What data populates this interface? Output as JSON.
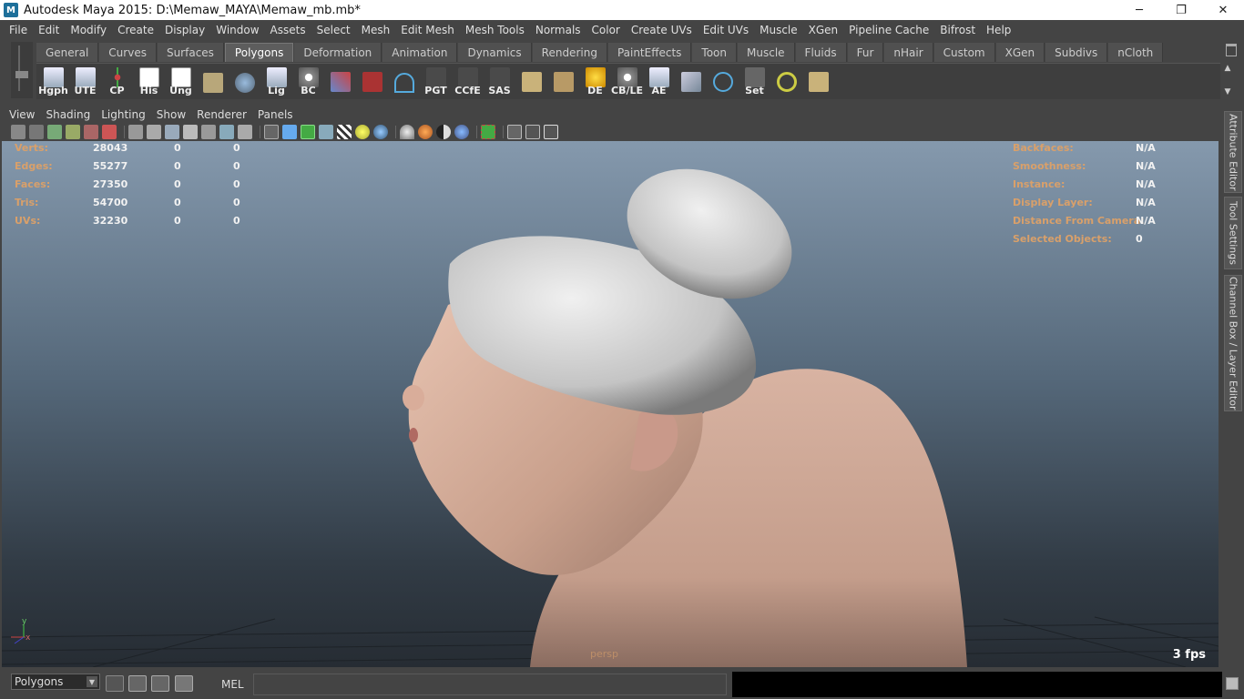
{
  "titlebar": {
    "title": "Autodesk Maya 2015: D:\\Memaw_MAYA\\Memaw_mb.mb*",
    "app_icon": "M",
    "minimize": "─",
    "restore": "❐",
    "close": "✕"
  },
  "menubar": [
    "File",
    "Edit",
    "Modify",
    "Create",
    "Display",
    "Window",
    "Assets",
    "Select",
    "Mesh",
    "Edit Mesh",
    "Mesh Tools",
    "Normals",
    "Color",
    "Create UVs",
    "Edit UVs",
    "Muscle",
    "XGen",
    "Pipeline Cache",
    "Bifrost",
    "Help"
  ],
  "shelf_tabs": [
    "General",
    "Curves",
    "Surfaces",
    "Polygons",
    "Deformation",
    "Animation",
    "Dynamics",
    "Rendering",
    "PaintEffects",
    "Toon",
    "Muscle",
    "Fluids",
    "Fur",
    "nHair",
    "Custom",
    "XGen",
    "Subdivs",
    "nCloth"
  ],
  "active_shelf_tab": "Polygons",
  "shelf_buttons": [
    "Hgph",
    "UTE",
    "CP",
    "His",
    "Ung",
    "",
    "",
    "Lig",
    "BC",
    "",
    "",
    "",
    "PGT",
    "CCfE",
    "SAS",
    "",
    "",
    "DE",
    "CB/LE",
    "AE",
    "",
    "",
    "Set",
    "",
    ""
  ],
  "panel_menu": [
    "View",
    "Shading",
    "Lighting",
    "Show",
    "Renderer",
    "Panels"
  ],
  "hud_left": {
    "rows": [
      {
        "label": "Verts:",
        "v1": "28043",
        "v2": "0",
        "v3": "0"
      },
      {
        "label": "Edges:",
        "v1": "55277",
        "v2": "0",
        "v3": "0"
      },
      {
        "label": "Faces:",
        "v1": "27350",
        "v2": "0",
        "v3": "0"
      },
      {
        "label": "Tris:",
        "v1": "54700",
        "v2": "0",
        "v3": "0"
      },
      {
        "label": "UVs:",
        "v1": "32230",
        "v2": "0",
        "v3": "0"
      }
    ]
  },
  "hud_right": {
    "rows": [
      {
        "label": "Backfaces:",
        "value": "N/A"
      },
      {
        "label": "Smoothness:",
        "value": "N/A"
      },
      {
        "label": "Instance:",
        "value": "N/A"
      },
      {
        "label": "Display Layer:",
        "value": "N/A"
      },
      {
        "label": "Distance From Camera:",
        "value": "N/A"
      },
      {
        "label": "Selected Objects:",
        "value": "0"
      }
    ]
  },
  "viewport": {
    "camera": "persp",
    "fps": "3 fps",
    "axis_y": "y",
    "axis_x": "x"
  },
  "right_dock": [
    "Attribute Editor",
    "Tool Settings",
    "Channel Box / Layer Editor"
  ],
  "cmdline": {
    "mode": "Polygons",
    "mel_label": "MEL"
  },
  "colors": {
    "hud_label": "#d9a06a",
    "skin": "#c9a08c",
    "hair": "#c8c8c8"
  }
}
